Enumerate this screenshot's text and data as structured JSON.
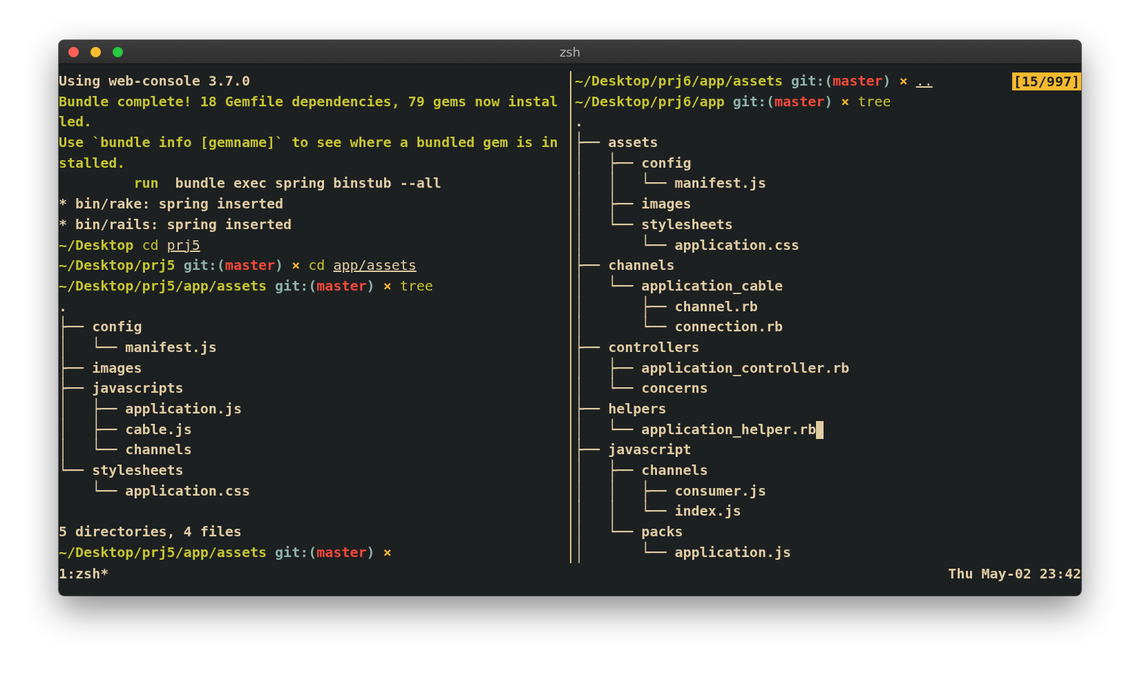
{
  "window": {
    "title": "zsh"
  },
  "panes": [
    {
      "blocks": [
        {
          "lines": [
            {
              "segments": [
                {
                  "kind": "text",
                  "text": "Using web-console 3.7.0"
                }
              ]
            },
            {
              "segments": [
                {
                  "kind": "note",
                  "text": "Bundle complete! 18 Gemfile dependencies, 79 gems now instal"
                }
              ]
            },
            {
              "segments": [
                {
                  "kind": "note",
                  "text": "led."
                }
              ]
            },
            {
              "segments": [
                {
                  "kind": "note",
                  "text": "Use `bundle info [gemname]` to see where a bundled gem is in"
                }
              ]
            },
            {
              "segments": [
                {
                  "kind": "note",
                  "text": "stalled."
                }
              ]
            },
            {
              "segments": [
                {
                  "kind": "verb",
                  "text": "         run"
                },
                {
                  "kind": "text",
                  "text": "  bundle exec spring binstub --all"
                }
              ]
            },
            {
              "segments": [
                {
                  "kind": "text",
                  "text": "* bin/rake: spring inserted"
                }
              ]
            },
            {
              "segments": [
                {
                  "kind": "text",
                  "text": "* bin/rails: spring inserted"
                }
              ]
            },
            {
              "segments": [
                {
                  "kind": "path",
                  "text": "~/Desktop"
                },
                {
                  "kind": "cmd",
                  "text": " cd"
                },
                {
                  "kind": "arg",
                  "text": " prj5"
                }
              ]
            },
            {
              "segments": [
                {
                  "kind": "path",
                  "text": "~/Desktop/prj5"
                },
                {
                  "kind": "git",
                  "text": " git:("
                },
                {
                  "kind": "branch",
                  "text": "master"
                },
                {
                  "kind": "git",
                  "text": ")"
                },
                {
                  "kind": "dirty",
                  "text": " ×"
                },
                {
                  "kind": "cmd",
                  "text": " cd"
                },
                {
                  "kind": "arg",
                  "text": " app/assets"
                }
              ]
            },
            {
              "segments": [
                {
                  "kind": "path",
                  "text": "~/Desktop/prj5/app/assets"
                },
                {
                  "kind": "git",
                  "text": " git:("
                },
                {
                  "kind": "branch",
                  "text": "master"
                },
                {
                  "kind": "git",
                  "text": ")"
                },
                {
                  "kind": "dirty",
                  "text": " ×"
                },
                {
                  "kind": "cmd",
                  "text": " tree"
                }
              ]
            },
            {
              "segments": [
                {
                  "kind": "text",
                  "text": "."
                }
              ]
            },
            {
              "segments": [
                {
                  "kind": "tree",
                  "text": "├── "
                },
                {
                  "kind": "entry",
                  "text": "config"
                }
              ]
            },
            {
              "segments": [
                {
                  "kind": "tree",
                  "text": "│   └── "
                },
                {
                  "kind": "entry",
                  "text": "manifest.js"
                }
              ]
            },
            {
              "segments": [
                {
                  "kind": "tree",
                  "text": "├── "
                },
                {
                  "kind": "entry",
                  "text": "images"
                }
              ]
            },
            {
              "segments": [
                {
                  "kind": "tree",
                  "text": "├── "
                },
                {
                  "kind": "entry",
                  "text": "javascripts"
                }
              ]
            },
            {
              "segments": [
                {
                  "kind": "tree",
                  "text": "│   ├── "
                },
                {
                  "kind": "entry",
                  "text": "application.js"
                }
              ]
            },
            {
              "segments": [
                {
                  "kind": "tree",
                  "text": "│   ├── "
                },
                {
                  "kind": "entry",
                  "text": "cable.js"
                }
              ]
            },
            {
              "segments": [
                {
                  "kind": "tree",
                  "text": "│   └── "
                },
                {
                  "kind": "entry",
                  "text": "channels"
                }
              ]
            },
            {
              "segments": [
                {
                  "kind": "tree",
                  "text": "└── "
                },
                {
                  "kind": "entry",
                  "text": "stylesheets"
                }
              ]
            },
            {
              "segments": [
                {
                  "kind": "tree",
                  "text": "    └── "
                },
                {
                  "kind": "entry",
                  "text": "application.css"
                }
              ]
            }
          ]
        },
        {
          "lines": [
            {
              "segments": [
                {
                  "kind": "text",
                  "text": "5 directories, 4 files"
                }
              ]
            },
            {
              "segments": [
                {
                  "kind": "path",
                  "text": "~/Desktop/prj5/app/assets"
                },
                {
                  "kind": "git",
                  "text": " git:("
                },
                {
                  "kind": "branch",
                  "text": "master"
                },
                {
                  "kind": "git",
                  "text": ")"
                },
                {
                  "kind": "dirty",
                  "text": " ×"
                }
              ]
            }
          ]
        }
      ]
    },
    {
      "blocks": [
        {
          "lines": [
            {
              "segments": [
                {
                  "kind": "path",
                  "text": "~/Desktop/prj6/app/assets"
                },
                {
                  "kind": "git",
                  "text": " git:("
                },
                {
                  "kind": "branch",
                  "text": "master"
                },
                {
                  "kind": "git",
                  "text": ")"
                },
                {
                  "kind": "dirty",
                  "text": " ×"
                },
                {
                  "kind": "arg",
                  "text": " .."
                }
              ],
              "badge": "[15/997]"
            },
            {
              "segments": [
                {
                  "kind": "path",
                  "text": "~/Desktop/prj6/app"
                },
                {
                  "kind": "git",
                  "text": " git:("
                },
                {
                  "kind": "branch",
                  "text": "master"
                },
                {
                  "kind": "git",
                  "text": ")"
                },
                {
                  "kind": "dirty",
                  "text": " ×"
                },
                {
                  "kind": "cmd",
                  "text": " tree"
                }
              ]
            },
            {
              "segments": [
                {
                  "kind": "text",
                  "text": "."
                }
              ]
            },
            {
              "segments": [
                {
                  "kind": "tree",
                  "text": "├── "
                },
                {
                  "kind": "entry",
                  "text": "assets"
                }
              ]
            },
            {
              "segments": [
                {
                  "kind": "tree",
                  "text": "│   ├── "
                },
                {
                  "kind": "entry",
                  "text": "config"
                }
              ]
            },
            {
              "segments": [
                {
                  "kind": "tree",
                  "text": "│   │   └── "
                },
                {
                  "kind": "entry",
                  "text": "manifest.js"
                }
              ]
            },
            {
              "segments": [
                {
                  "kind": "tree",
                  "text": "│   ├── "
                },
                {
                  "kind": "entry",
                  "text": "images"
                }
              ]
            },
            {
              "segments": [
                {
                  "kind": "tree",
                  "text": "│   └── "
                },
                {
                  "kind": "entry",
                  "text": "stylesheets"
                }
              ]
            },
            {
              "segments": [
                {
                  "kind": "tree",
                  "text": "│       └── "
                },
                {
                  "kind": "entry",
                  "text": "application.css"
                }
              ]
            },
            {
              "segments": [
                {
                  "kind": "tree",
                  "text": "├── "
                },
                {
                  "kind": "entry",
                  "text": "channels"
                }
              ]
            },
            {
              "segments": [
                {
                  "kind": "tree",
                  "text": "│   └── "
                },
                {
                  "kind": "entry",
                  "text": "application_cable"
                }
              ]
            },
            {
              "segments": [
                {
                  "kind": "tree",
                  "text": "│       ├── "
                },
                {
                  "kind": "entry",
                  "text": "channel.rb"
                }
              ]
            },
            {
              "segments": [
                {
                  "kind": "tree",
                  "text": "│       └── "
                },
                {
                  "kind": "entry",
                  "text": "connection.rb"
                }
              ]
            },
            {
              "segments": [
                {
                  "kind": "tree",
                  "text": "├── "
                },
                {
                  "kind": "entry",
                  "text": "controllers"
                }
              ]
            },
            {
              "segments": [
                {
                  "kind": "tree",
                  "text": "│   ├── "
                },
                {
                  "kind": "entry",
                  "text": "application_controller.rb"
                }
              ]
            },
            {
              "segments": [
                {
                  "kind": "tree",
                  "text": "│   └── "
                },
                {
                  "kind": "entry",
                  "text": "concerns"
                }
              ]
            },
            {
              "segments": [
                {
                  "kind": "tree",
                  "text": "├── "
                },
                {
                  "kind": "entry",
                  "text": "helpers"
                }
              ]
            },
            {
              "segments": [
                {
                  "kind": "tree",
                  "text": "│   └── "
                },
                {
                  "kind": "entry",
                  "text": "application_helper.rb"
                }
              ],
              "cursor": true
            },
            {
              "segments": [
                {
                  "kind": "tree",
                  "text": "├── "
                },
                {
                  "kind": "entry",
                  "text": "javascript"
                }
              ]
            },
            {
              "segments": [
                {
                  "kind": "tree",
                  "text": "│   ├── "
                },
                {
                  "kind": "entry",
                  "text": "channels"
                }
              ]
            },
            {
              "segments": [
                {
                  "kind": "tree",
                  "text": "│   │   ├── "
                },
                {
                  "kind": "entry",
                  "text": "consumer.js"
                }
              ]
            },
            {
              "segments": [
                {
                  "kind": "tree",
                  "text": "│   │   └── "
                },
                {
                  "kind": "entry",
                  "text": "index.js"
                }
              ]
            },
            {
              "segments": [
                {
                  "kind": "tree",
                  "text": "│   └── "
                },
                {
                  "kind": "entry",
                  "text": "packs"
                }
              ]
            },
            {
              "segments": [
                {
                  "kind": "tree",
                  "text": "│       └── "
                },
                {
                  "kind": "entry",
                  "text": "application.js"
                }
              ]
            }
          ]
        }
      ]
    }
  ],
  "status_bar": {
    "window_list": "1:zsh*",
    "clock": "Thu May-02 23:42"
  }
}
